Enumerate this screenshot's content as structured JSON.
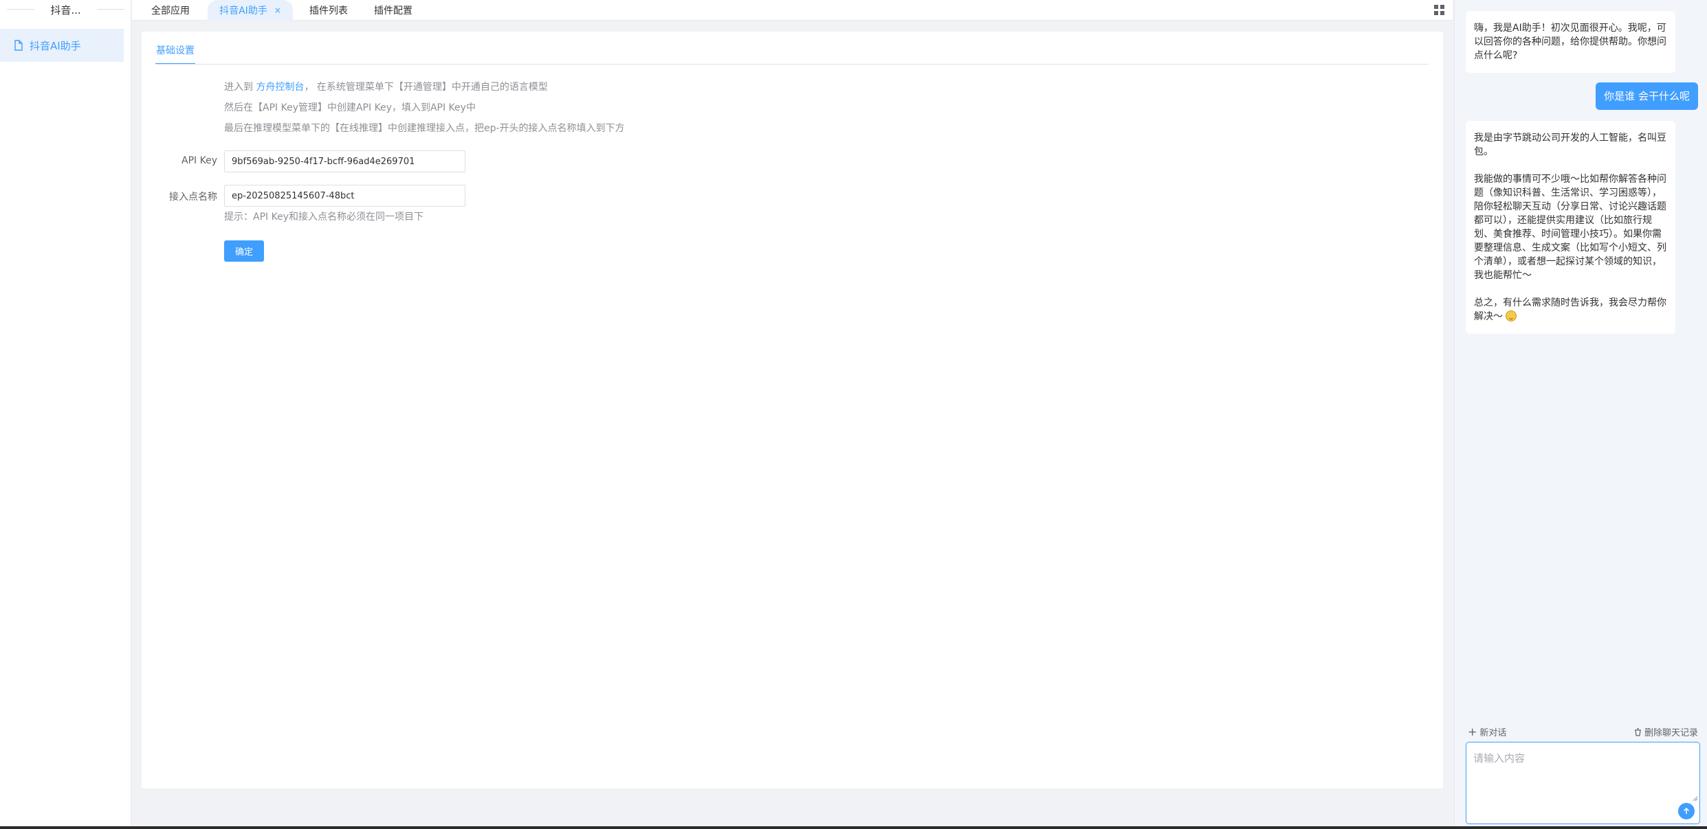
{
  "sidebar": {
    "title": "抖音...",
    "items": [
      {
        "label": "抖音AI助手"
      }
    ]
  },
  "tabs": [
    {
      "label": "全部应用"
    },
    {
      "label": "抖音AI助手",
      "close": "×"
    },
    {
      "label": "插件列表"
    },
    {
      "label": "插件配置"
    }
  ],
  "main": {
    "subtab": "基础设置",
    "instructions": {
      "line1_prefix": "进入到 ",
      "line1_link": "方舟控制台",
      "line1_suffix": "，  在系统管理菜单下【开通管理】中开通自己的语言模型",
      "line2": "然后在【API Key管理】中创建API Key，填入到API Key中",
      "line3": "最后在推理模型菜单下的【在线推理】中创建推理接入点，把ep-开头的接入点名称填入到下方"
    },
    "form": {
      "api_key_label": "API Key",
      "api_key_value": "9bf569ab-9250-4f17-bcff-96ad4e269701",
      "endpoint_label": "接入点名称",
      "endpoint_value": "ep-20250825145607-48bct",
      "hint": "提示：API Key和接入点名称必须在同一项目下",
      "confirm_label": "确定"
    }
  },
  "chat": {
    "messages": [
      {
        "role": "ai",
        "text": "嗨，我是AI助手！初次见面很开心。我呢，可以回答你的各种问题，给你提供帮助。你想问点什么呢?"
      },
      {
        "role": "user",
        "text": "你是谁 会干什么呢"
      },
      {
        "role": "ai",
        "p1": "我是由字节跳动公司开发的人工智能，名叫豆包。",
        "p2": "我能做的事情可不少哦～比如帮你解答各种问题（像知识科普、生活常识、学习困惑等），陪你轻松聊天互动（分享日常、讨论兴趣话题都可以），还能提供实用建议（比如旅行规划、美食推荐、时间管理小技巧）。如果你需要整理信息、生成文案（比如写个小短文、列个清单），或者想一起探讨某个领域的知识，我也能帮忙～",
        "p3": "总之，有什么需求随时告诉我，我会尽力帮你解决～"
      }
    ],
    "new_chat_label": "新对话",
    "delete_label": "删除聊天记录",
    "input_placeholder": "请输入内容"
  },
  "colors": {
    "accent": "#409eff",
    "active_bg": "#e8f1fc"
  }
}
